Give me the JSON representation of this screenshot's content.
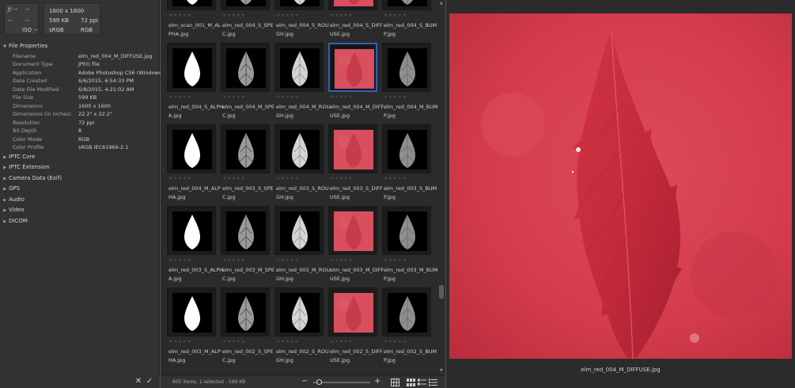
{
  "camera_info": {
    "fstop": "ƒ/ --",
    "shutter": "--",
    "left2": "--",
    "left3": "--",
    "iso": "ISO --",
    "dimensions": "1600 x 1600",
    "size": "599 KB",
    "ppi": "72 ppi",
    "colorspace": "sRGB",
    "mode": "RGB"
  },
  "metadata": {
    "file_properties_label": "File Properties",
    "properties": [
      {
        "key": "Filename",
        "value": "elm_red_004_M_DIFFUSE.jpg"
      },
      {
        "key": "Document Type",
        "value": "JPEG file"
      },
      {
        "key": "Application",
        "value": "Adobe Photoshop CS6 (Windows)"
      },
      {
        "key": "Date Created",
        "value": "6/6/2015, 6:54:33 PM"
      },
      {
        "key": "Date File Modified",
        "value": "6/8/2015, 4:21:02 AM"
      },
      {
        "key": "File Size",
        "value": "599 KB"
      },
      {
        "key": "Dimensions",
        "value": "1600 x 1600"
      },
      {
        "key": "Dimensions (in inches)",
        "value": "22.2\" x 22.2\""
      },
      {
        "key": "Resolution",
        "value": "72 ppi"
      },
      {
        "key": "Bit Depth",
        "value": "8"
      },
      {
        "key": "Color Mode",
        "value": "RGB"
      },
      {
        "key": "Color Profile",
        "value": "sRGB IEC61966-2.1"
      }
    ],
    "collapsed_sections": [
      "IPTC Core",
      "IPTC Extension",
      "Camera Data (Exif)",
      "GPS",
      "Audio",
      "Video",
      "DICOM"
    ]
  },
  "left_bottom": {
    "cancel_glyph": "✕",
    "apply_glyph": "✓"
  },
  "thumbnails": [
    {
      "name": "elm_scan_001_M_ALPHA.jpg",
      "kind": "alpha",
      "selected": false
    },
    {
      "name": "elm_red_004_S_SPEC.jpg",
      "kind": "spec",
      "selected": false
    },
    {
      "name": "elm_red_004_S_ROUGH.jpg",
      "kind": "rough",
      "selected": false
    },
    {
      "name": "elm_red_004_S_DIFFUSE.jpg",
      "kind": "diffuse",
      "selected": false
    },
    {
      "name": "elm_red_004_S_BUMP.jpg",
      "kind": "bump",
      "selected": false
    },
    {
      "name": "elm_red_004_S_ALPHA.jpg",
      "kind": "alpha",
      "selected": false
    },
    {
      "name": "elm_red_004_M_SPEC.jpg",
      "kind": "spec",
      "selected": false
    },
    {
      "name": "elm_red_004_M_ROUGH.jpg",
      "kind": "rough",
      "selected": false
    },
    {
      "name": "elm_red_004_M_DIFFUSE.jpg",
      "kind": "diffuse",
      "selected": true
    },
    {
      "name": "elm_red_004_M_BUMP.jpg",
      "kind": "bump",
      "selected": false
    },
    {
      "name": "elm_red_004_M_ALPHA.jpg",
      "kind": "alpha",
      "selected": false
    },
    {
      "name": "elm_red_003_S_SPEC.jpg",
      "kind": "spec",
      "selected": false
    },
    {
      "name": "elm_red_003_S_ROUGH.jpg",
      "kind": "rough",
      "selected": false
    },
    {
      "name": "elm_red_003_S_DIFFUSE.jpg",
      "kind": "diffuse",
      "selected": false
    },
    {
      "name": "elm_red_003_S_BUMP.jpg",
      "kind": "bump",
      "selected": false
    },
    {
      "name": "elm_red_003_S_ALPHA.jpg",
      "kind": "alpha",
      "selected": false
    },
    {
      "name": "elm_red_003_M_SPEC.jpg",
      "kind": "spec",
      "selected": false
    },
    {
      "name": "elm_red_003_M_ROUGH.jpg",
      "kind": "rough",
      "selected": false
    },
    {
      "name": "elm_red_003_M_DIFFUSE.jpg",
      "kind": "diffuse",
      "selected": false
    },
    {
      "name": "elm_red_003_M_BUMP.jpg",
      "kind": "bump",
      "selected": false
    },
    {
      "name": "elm_red_003_M_ALPHA.jpg",
      "kind": "alpha",
      "selected": false
    },
    {
      "name": "elm_red_002_S_SPEC.jpg",
      "kind": "spec",
      "selected": false
    },
    {
      "name": "elm_red_002_S_ROUGH.jpg",
      "kind": "rough",
      "selected": false
    },
    {
      "name": "elm_red_002_S_DIFFUSE.jpg",
      "kind": "diffuse",
      "selected": false
    },
    {
      "name": "elm_red_002_S_BUMP.jpg",
      "kind": "bump",
      "selected": false
    }
  ],
  "status": {
    "text": "605 items, 1 selected - 599 KB",
    "zoom_minus": "−",
    "zoom_plus": "+"
  },
  "preview": {
    "caption": "elm_red_004_M_DIFFUSE.jpg"
  },
  "colors": {
    "selection": "#2f63b8",
    "leaf_red": "#c62a3a",
    "background_red": "#d43e4e"
  }
}
